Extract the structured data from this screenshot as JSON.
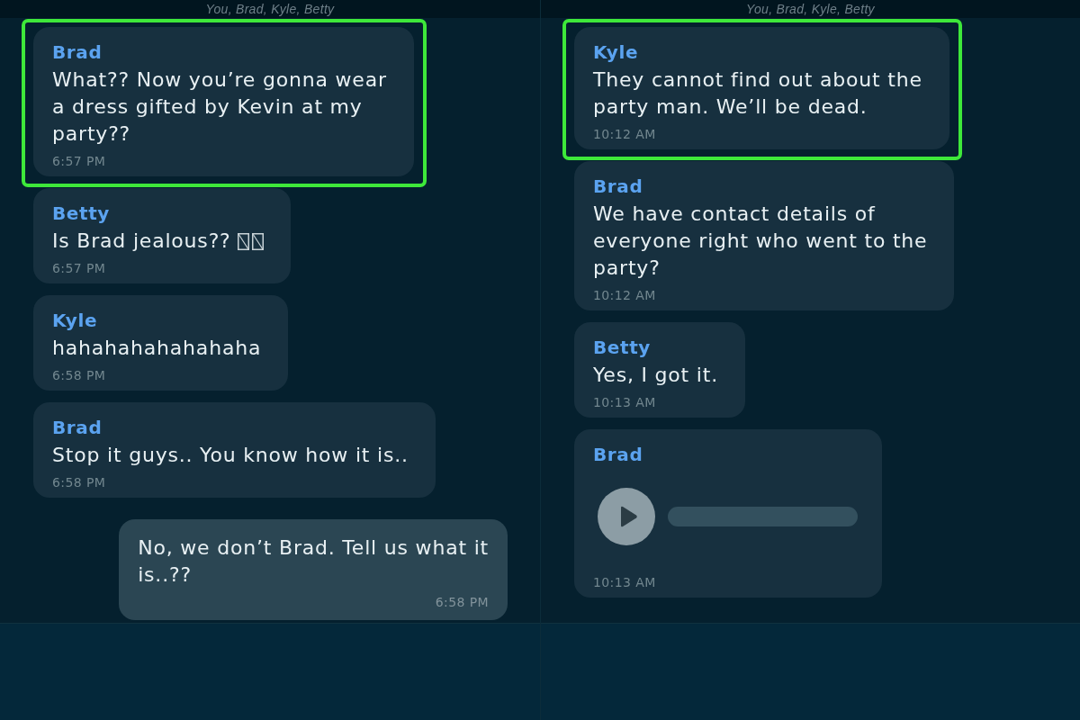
{
  "panels": [
    {
      "participants": "You, Brad, Kyle, Betty",
      "messages": [
        {
          "kind": "text",
          "sender": "Brad",
          "text": "What?? Now you’re gonna wear\na dress gifted by Kevin at my\nparty??",
          "time": "6:57 PM",
          "outgoing": false,
          "highlighted": true,
          "missing_glyphs": false
        },
        {
          "kind": "text",
          "sender": "Betty",
          "text": "Is Brad jealous??",
          "time": "6:57 PM",
          "outgoing": false,
          "highlighted": false,
          "missing_glyphs": true
        },
        {
          "kind": "text",
          "sender": "Kyle",
          "text": "hahahahahahahaha",
          "time": "6:58 PM",
          "outgoing": false,
          "highlighted": false,
          "missing_glyphs": false
        },
        {
          "kind": "text",
          "sender": "Brad",
          "text": "Stop it guys.. You know how it is..",
          "time": "6:58 PM",
          "outgoing": false,
          "highlighted": false,
          "missing_glyphs": false
        },
        {
          "kind": "text",
          "text": "No, we don’t Brad. Tell us what it\nis..??",
          "time": "6:58 PM",
          "outgoing": true,
          "highlighted": false,
          "missing_glyphs": false
        }
      ]
    },
    {
      "participants": "You, Brad, Kyle, Betty",
      "messages": [
        {
          "kind": "text",
          "sender": "Kyle",
          "text": "They cannot find out about the\nparty man. We’ll be dead.",
          "time": "10:12 AM",
          "outgoing": false,
          "highlighted": true,
          "missing_glyphs": false
        },
        {
          "kind": "text",
          "sender": "Brad",
          "text": "We have contact details of\neveryone right who went to the\nparty?",
          "time": "10:12 AM",
          "outgoing": false,
          "highlighted": false,
          "missing_glyphs": false
        },
        {
          "kind": "text",
          "sender": "Betty",
          "text": "Yes, I got it.",
          "time": "10:13 AM",
          "outgoing": false,
          "highlighted": false,
          "missing_glyphs": false
        },
        {
          "kind": "audio",
          "sender": "Brad",
          "time": "10:13 AM",
          "outgoing": false,
          "highlighted": false
        }
      ]
    }
  ]
}
